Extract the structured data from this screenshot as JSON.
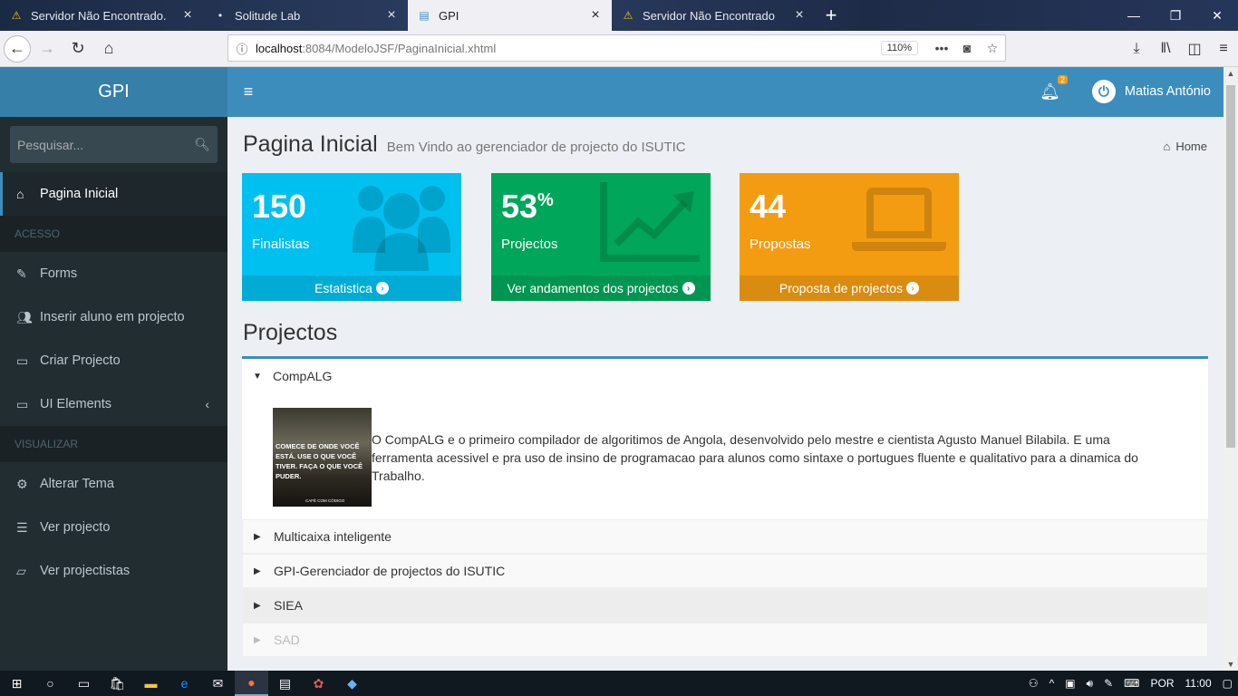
{
  "browser": {
    "tabs": [
      {
        "title": "Servidor Não Encontrado.",
        "icon": "warning-icon",
        "active": false
      },
      {
        "title": "Solitude Lab",
        "icon": "dot-icon",
        "active": false
      },
      {
        "title": "GPI",
        "icon": "page-icon",
        "active": true
      },
      {
        "title": "Servidor Não Encontrado",
        "icon": "warning-icon",
        "active": false
      }
    ],
    "url_host": "localhost",
    "url_path": ":8084/ModeloJSF/PaginaInicial.xhtml",
    "zoom": "110%"
  },
  "app": {
    "logo": "GPI",
    "search_placeholder": "Pesquisar...",
    "user_name": "Matias António",
    "notification_count": "2",
    "accent": "#3c8dbc"
  },
  "sidebar": {
    "items": [
      {
        "label": "Pagina Inicial",
        "icon": "home-icon"
      },
      {
        "label": "Forms",
        "icon": "edit-icon"
      },
      {
        "label": "Inserir aluno em projecto",
        "icon": "users-icon"
      },
      {
        "label": "Criar Projecto",
        "icon": "laptop-icon"
      },
      {
        "label": "UI Elements",
        "icon": "laptop-icon"
      },
      {
        "label": "Alterar Tema",
        "icon": "cogs-icon"
      },
      {
        "label": "Ver projecto",
        "icon": "list-icon"
      },
      {
        "label": "Ver projectistas",
        "icon": "folder-icon"
      }
    ],
    "headers": [
      "ACESSO",
      "VISUALIZAR"
    ]
  },
  "page": {
    "title": "Pagina Inicial",
    "subtitle": "Bem Vindo ao gerenciador de projecto do ISUTIC",
    "breadcrumb": "Home"
  },
  "stats": [
    {
      "value": "150",
      "sup": "",
      "label": "Finalistas",
      "footer": "Estatistica",
      "color": "#00c0ef",
      "icon": "users-icon"
    },
    {
      "value": "53",
      "sup": "%",
      "label": "Projectos",
      "footer": "Ver andamentos dos projectos",
      "color": "#00a65a",
      "icon": "line-chart-icon"
    },
    {
      "value": "44",
      "sup": "",
      "label": "Propostas",
      "footer": "Proposta de projectos",
      "color": "#f39c12",
      "icon": "laptop-icon"
    }
  ],
  "projects": {
    "title": "Projectos",
    "open": {
      "name": "CompALG",
      "image_text": "COMECE DE ONDE VOCÊ ESTÁ. USE O QUE VOCÊ TIVER. FAÇA O QUE VOCÊ PUDER.",
      "image_caption": "CAFÉ COM CÓDIGO",
      "description": "O CompALG e o primeiro compilador de algoritimos de Angola, desenvolvido pelo mestre e cientista Agusto Manuel Bilabila. E uma ferramenta acessivel e pra uso de insino de programacao para alunos como sintaxe o portugues fluente e qualitativo para a dinamica do Trabalho."
    },
    "collapsed": [
      "Multicaixa inteligente",
      "GPI-Gerenciador de projectos do ISUTIC",
      "SIEA",
      "SAD"
    ]
  },
  "taskbar": {
    "lang": "POR",
    "time": "11:00"
  }
}
